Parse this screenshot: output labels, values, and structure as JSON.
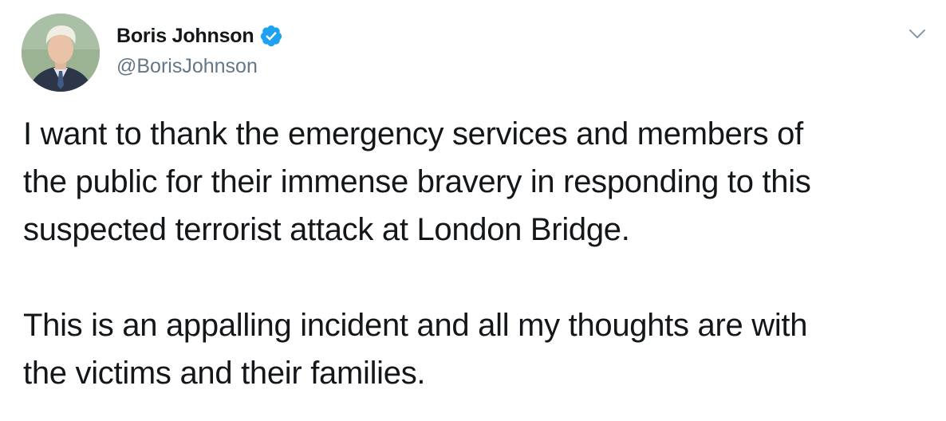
{
  "tweet": {
    "author": {
      "display_name": "Boris Johnson",
      "handle": "@BorisJohnson",
      "verified": true,
      "avatar": "profile-photo"
    },
    "menu_icon": "chevron-down-icon",
    "verified_icon": "verified-badge-icon",
    "paragraphs": [
      "I want to thank the emergency services and members of\nthe public for their immense bravery in responding to this\nsuspected terrorist attack at London Bridge.",
      "This is an appalling incident and all my thoughts are with\nthe victims and their families."
    ]
  },
  "colors": {
    "text": "#14171a",
    "secondary_text": "#657786",
    "verified_blue": "#1da1f2"
  }
}
